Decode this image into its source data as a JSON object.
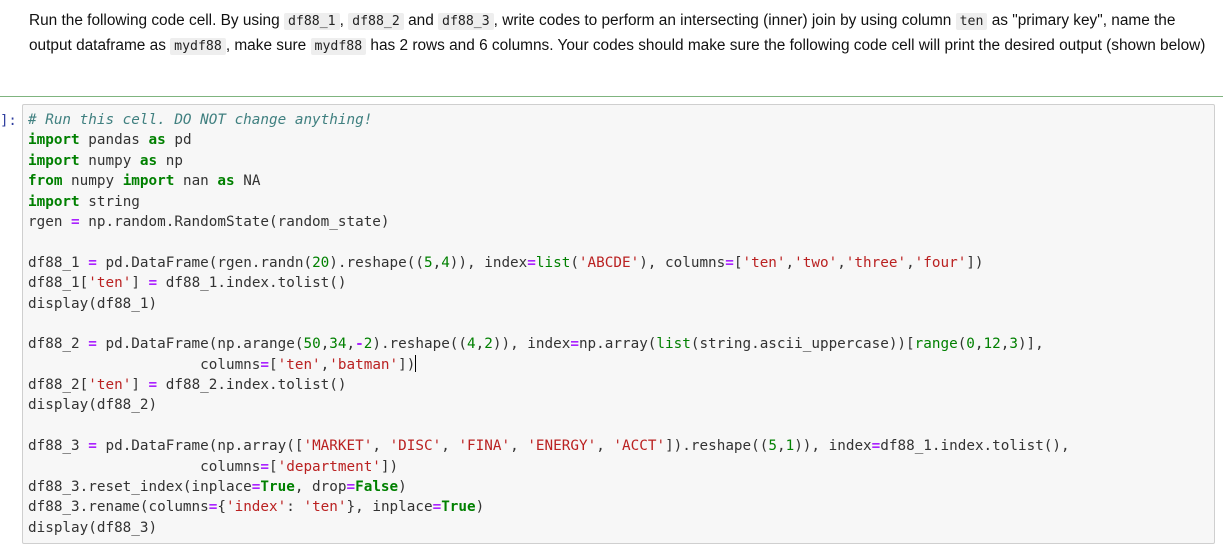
{
  "markdown": {
    "segments": [
      {
        "type": "text",
        "value": "Run the following code cell. By using "
      },
      {
        "type": "code",
        "value": "df88_1"
      },
      {
        "type": "text",
        "value": ", "
      },
      {
        "type": "code",
        "value": "df88_2"
      },
      {
        "type": "text",
        "value": " and "
      },
      {
        "type": "code",
        "value": "df88_3"
      },
      {
        "type": "text",
        "value": ", write codes to perform an intersecting (inner) join by using column "
      },
      {
        "type": "code",
        "value": "ten"
      },
      {
        "type": "text",
        "value": " as \"primary key\", name the output dataframe as "
      },
      {
        "type": "code",
        "value": "mydf88"
      },
      {
        "type": "text",
        "value": ", make sure "
      },
      {
        "type": "code",
        "value": "mydf88"
      },
      {
        "type": "text",
        "value": " has 2 rows and 6 columns. Your codes should make sure the following code cell will print the desired output (shown below)"
      }
    ]
  },
  "code_cell": {
    "prompt": "]:",
    "cursor_line": 12,
    "lines": [
      [
        {
          "c": "cm",
          "t": "# Run this cell. DO NOT change anything!"
        }
      ],
      [
        {
          "c": "kw",
          "t": "import"
        },
        {
          "c": "nm",
          "t": " pandas "
        },
        {
          "c": "kw",
          "t": "as"
        },
        {
          "c": "nm",
          "t": " pd"
        }
      ],
      [
        {
          "c": "kw",
          "t": "import"
        },
        {
          "c": "nm",
          "t": " numpy "
        },
        {
          "c": "kw",
          "t": "as"
        },
        {
          "c": "nm",
          "t": " np"
        }
      ],
      [
        {
          "c": "kw",
          "t": "from"
        },
        {
          "c": "nm",
          "t": " numpy "
        },
        {
          "c": "kw",
          "t": "import"
        },
        {
          "c": "nm",
          "t": " nan "
        },
        {
          "c": "kw",
          "t": "as"
        },
        {
          "c": "nm",
          "t": " NA"
        }
      ],
      [
        {
          "c": "kw",
          "t": "import"
        },
        {
          "c": "nm",
          "t": " string"
        }
      ],
      [
        {
          "c": "nm",
          "t": "rgen "
        },
        {
          "c": "op",
          "t": "="
        },
        {
          "c": "nm",
          "t": " np.random.RandomState(random_state)"
        }
      ],
      [],
      [
        {
          "c": "nm",
          "t": "df88_1 "
        },
        {
          "c": "op",
          "t": "="
        },
        {
          "c": "nm",
          "t": " pd.DataFrame(rgen.randn("
        },
        {
          "c": "nu",
          "t": "20"
        },
        {
          "c": "nm",
          "t": ").reshape(("
        },
        {
          "c": "nu",
          "t": "5"
        },
        {
          "c": "nm",
          "t": ","
        },
        {
          "c": "nu",
          "t": "4"
        },
        {
          "c": "nm",
          "t": ")), index"
        },
        {
          "c": "op",
          "t": "="
        },
        {
          "c": "bi",
          "t": "list"
        },
        {
          "c": "nm",
          "t": "("
        },
        {
          "c": "st",
          "t": "'ABCDE'"
        },
        {
          "c": "nm",
          "t": "), columns"
        },
        {
          "c": "op",
          "t": "="
        },
        {
          "c": "nm",
          "t": "["
        },
        {
          "c": "st",
          "t": "'ten'"
        },
        {
          "c": "nm",
          "t": ","
        },
        {
          "c": "st",
          "t": "'two'"
        },
        {
          "c": "nm",
          "t": ","
        },
        {
          "c": "st",
          "t": "'three'"
        },
        {
          "c": "nm",
          "t": ","
        },
        {
          "c": "st",
          "t": "'four'"
        },
        {
          "c": "nm",
          "t": "])"
        }
      ],
      [
        {
          "c": "nm",
          "t": "df88_1["
        },
        {
          "c": "st",
          "t": "'ten'"
        },
        {
          "c": "nm",
          "t": "] "
        },
        {
          "c": "op",
          "t": "="
        },
        {
          "c": "nm",
          "t": " df88_1.index.tolist()"
        }
      ],
      [
        {
          "c": "nm",
          "t": "display(df88_1)"
        }
      ],
      [],
      [
        {
          "c": "nm",
          "t": "df88_2 "
        },
        {
          "c": "op",
          "t": "="
        },
        {
          "c": "nm",
          "t": " pd.DataFrame(np.arange("
        },
        {
          "c": "nu",
          "t": "50"
        },
        {
          "c": "nm",
          "t": ","
        },
        {
          "c": "nu",
          "t": "34"
        },
        {
          "c": "nm",
          "t": ","
        },
        {
          "c": "op",
          "t": "-"
        },
        {
          "c": "nu",
          "t": "2"
        },
        {
          "c": "nm",
          "t": ").reshape(("
        },
        {
          "c": "nu",
          "t": "4"
        },
        {
          "c": "nm",
          "t": ","
        },
        {
          "c": "nu",
          "t": "2"
        },
        {
          "c": "nm",
          "t": ")), index"
        },
        {
          "c": "op",
          "t": "="
        },
        {
          "c": "nm",
          "t": "np.array("
        },
        {
          "c": "bi",
          "t": "list"
        },
        {
          "c": "nm",
          "t": "(string.ascii_uppercase))["
        },
        {
          "c": "bi",
          "t": "range"
        },
        {
          "c": "nm",
          "t": "("
        },
        {
          "c": "nu",
          "t": "0"
        },
        {
          "c": "nm",
          "t": ","
        },
        {
          "c": "nu",
          "t": "12"
        },
        {
          "c": "nm",
          "t": ","
        },
        {
          "c": "nu",
          "t": "3"
        },
        {
          "c": "nm",
          "t": ")],"
        }
      ],
      [
        {
          "c": "nm",
          "t": "                    columns"
        },
        {
          "c": "op",
          "t": "="
        },
        {
          "c": "nm",
          "t": "["
        },
        {
          "c": "st",
          "t": "'ten'"
        },
        {
          "c": "nm",
          "t": ","
        },
        {
          "c": "st",
          "t": "'batman'"
        },
        {
          "c": "nm",
          "t": "])"
        }
      ],
      [
        {
          "c": "nm",
          "t": "df88_2["
        },
        {
          "c": "st",
          "t": "'ten'"
        },
        {
          "c": "nm",
          "t": "] "
        },
        {
          "c": "op",
          "t": "="
        },
        {
          "c": "nm",
          "t": " df88_2.index.tolist()"
        }
      ],
      [
        {
          "c": "nm",
          "t": "display(df88_2)"
        }
      ],
      [],
      [
        {
          "c": "nm",
          "t": "df88_3 "
        },
        {
          "c": "op",
          "t": "="
        },
        {
          "c": "nm",
          "t": " pd.DataFrame(np.array(["
        },
        {
          "c": "st",
          "t": "'MARKET'"
        },
        {
          "c": "nm",
          "t": ", "
        },
        {
          "c": "st",
          "t": "'DISC'"
        },
        {
          "c": "nm",
          "t": ", "
        },
        {
          "c": "st",
          "t": "'FINA'"
        },
        {
          "c": "nm",
          "t": ", "
        },
        {
          "c": "st",
          "t": "'ENERGY'"
        },
        {
          "c": "nm",
          "t": ", "
        },
        {
          "c": "st",
          "t": "'ACCT'"
        },
        {
          "c": "nm",
          "t": "]).reshape(("
        },
        {
          "c": "nu",
          "t": "5"
        },
        {
          "c": "nm",
          "t": ","
        },
        {
          "c": "nu",
          "t": "1"
        },
        {
          "c": "nm",
          "t": ")), index"
        },
        {
          "c": "op",
          "t": "="
        },
        {
          "c": "nm",
          "t": "df88_1.index.tolist(),"
        }
      ],
      [
        {
          "c": "nm",
          "t": "                    columns"
        },
        {
          "c": "op",
          "t": "="
        },
        {
          "c": "nm",
          "t": "["
        },
        {
          "c": "st",
          "t": "'department'"
        },
        {
          "c": "nm",
          "t": "])"
        }
      ],
      [
        {
          "c": "nm",
          "t": "df88_3.reset_index(inplace"
        },
        {
          "c": "op",
          "t": "="
        },
        {
          "c": "kw",
          "t": "True"
        },
        {
          "c": "nm",
          "t": ", drop"
        },
        {
          "c": "op",
          "t": "="
        },
        {
          "c": "kw",
          "t": "False"
        },
        {
          "c": "nm",
          "t": ")"
        }
      ],
      [
        {
          "c": "nm",
          "t": "df88_3.rename(columns"
        },
        {
          "c": "op",
          "t": "="
        },
        {
          "c": "nm",
          "t": "{"
        },
        {
          "c": "st",
          "t": "'index'"
        },
        {
          "c": "nm",
          "t": ": "
        },
        {
          "c": "st",
          "t": "'ten'"
        },
        {
          "c": "nm",
          "t": "}, inplace"
        },
        {
          "c": "op",
          "t": "="
        },
        {
          "c": "kw",
          "t": "True"
        },
        {
          "c": "nm",
          "t": ")"
        }
      ],
      [
        {
          "c": "nm",
          "t": "display(df88_3)"
        }
      ]
    ]
  }
}
